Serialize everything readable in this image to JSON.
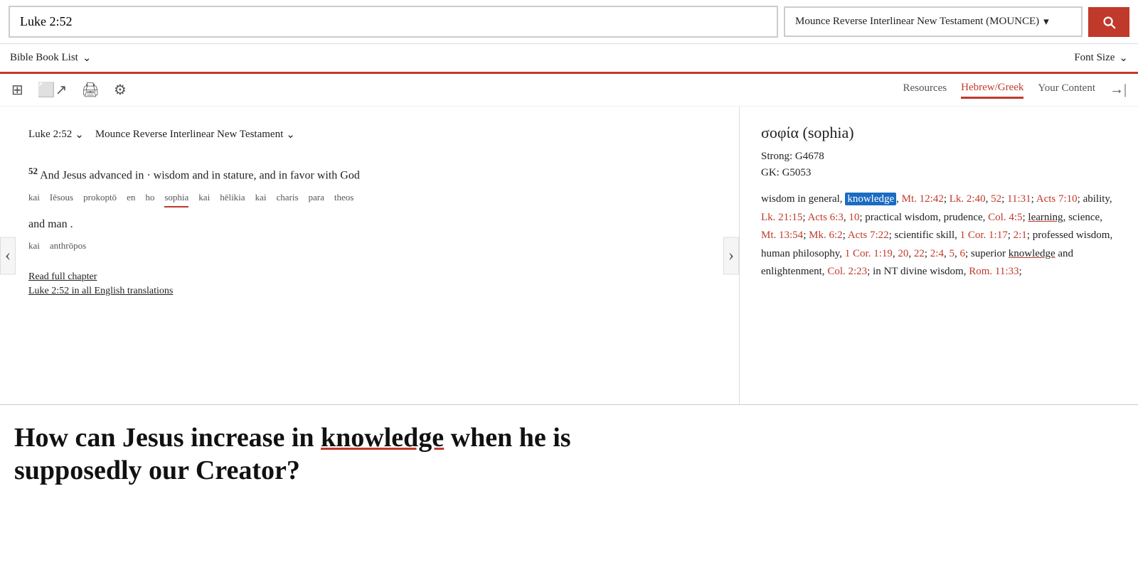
{
  "topbar": {
    "search_value": "Luke 2:52",
    "version_label": "Mounce Reverse Interlinear New Testament (MOUNCE)",
    "search_button_label": "Search"
  },
  "secondarybar": {
    "bible_book_list": "Bible Book List",
    "font_size": "Font Size"
  },
  "toolbar": {
    "tabs": [
      {
        "label": "Resources",
        "active": false
      },
      {
        "label": "Hebrew/Greek",
        "active": true
      },
      {
        "label": "Your Content",
        "active": false
      }
    ]
  },
  "bible_panel": {
    "reference": "Luke 2:52",
    "version": "Mounce Reverse Interlinear New Testament",
    "verse_num": "52",
    "verse_text": "And Jesus advanced in · wisdom and in stature, and in favor with God",
    "interlinear": [
      "kai",
      "Iēsous",
      "prokoptō",
      "en",
      "ho",
      "sophia",
      "kai",
      "hēlikia",
      "kai",
      "charis",
      "para",
      "theos"
    ],
    "verse_text2": "and man .",
    "interlinear2": [
      "kai",
      "anthrōpos"
    ],
    "read_full_chapter": "Read full chapter",
    "all_translations": "Luke 2:52 in all English translations"
  },
  "greek_panel": {
    "title": "σοφία (sophia)",
    "strong": "Strong: G4678",
    "gk": "GK: G5053",
    "definition": "wisdom in general, knowledge, Mt. 12:42; Lk. 2:40, 52; 11:31; Acts 7:10; ability, Lk. 21:15; Acts 6:3, 10; practical wisdom, prudence, Col. 4:5; learning, science, Mt. 13:54; Mk. 6:2; Acts 7:22; scientific skill, 1 Cor. 1:17; 2:1; professed wisdom, human philosophy, 1 Cor. 1:19, 20, 22; 2:4, 5, 6; superior knowledge and enlightenment, Col. 2:23; in NT divine wisdom, Rom. 11:33;"
  },
  "article": {
    "title": "How can Jesus increase in knowledge when he is supposedly our Creator?"
  }
}
